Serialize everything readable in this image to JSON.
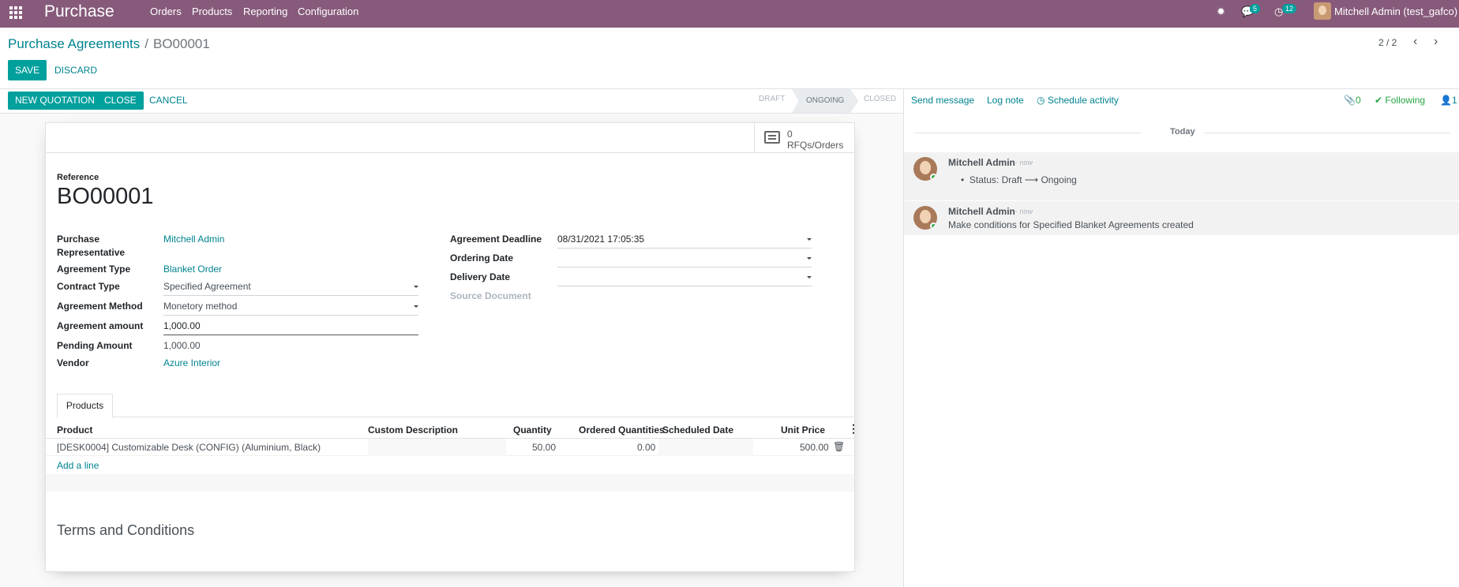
{
  "nav": {
    "brand": "Purchase",
    "menu": [
      "Orders",
      "Products",
      "Reporting",
      "Configuration"
    ],
    "bug_icon": "bug-icon",
    "messages_count": "5",
    "activities_count": "12",
    "user": "Mitchell Admin (test_gafco)"
  },
  "breadcrumb": {
    "parent": "Purchase Agreements",
    "current": "BO00001"
  },
  "actions": {
    "save": "SAVE",
    "discard": "DISCARD"
  },
  "pager": {
    "value": "2 / 2"
  },
  "header_buttons": {
    "new_quotation": "NEW QUOTATION",
    "close": "CLOSE",
    "cancel": "CANCEL"
  },
  "stages": [
    "DRAFT",
    "ONGOING",
    "CLOSED"
  ],
  "active_stage": "ONGOING",
  "stat_button": {
    "count": "0",
    "label": "RFQs/Orders"
  },
  "form": {
    "reference_label": "Reference",
    "reference": "BO00001",
    "purchase_rep_label_1": "Purchase",
    "purchase_rep_label_2": "Representative",
    "purchase_rep": "Mitchell Admin",
    "agreement_type_label": "Agreement Type",
    "agreement_type": "Blanket Order",
    "contract_type_label": "Contract Type",
    "contract_type": "Specified Agreement",
    "agreement_method_label": "Agreement Method",
    "agreement_method": "Monetory method",
    "agreement_amount_label": "Agreement amount",
    "agreement_amount": "1,000.00",
    "pending_amount_label": "Pending Amount",
    "pending_amount": "1,000.00",
    "vendor_label": "Vendor",
    "vendor": "Azure Interior",
    "deadline_label": "Agreement Deadline",
    "deadline": "08/31/2021 17:05:35",
    "ordering_date_label": "Ordering Date",
    "ordering_date": "",
    "delivery_date_label": "Delivery Date",
    "delivery_date": "",
    "source_doc_label": "Source Document"
  },
  "tabs": {
    "products": "Products"
  },
  "table": {
    "headers": [
      "Product",
      "Custom Description",
      "Quantity",
      "Ordered Quantities",
      "Scheduled Date",
      "Unit Price"
    ],
    "rows": [
      {
        "product": "[DESK0004] Customizable Desk (CONFIG) (Aluminium, Black)",
        "custom_description": "",
        "quantity": "50.00",
        "ordered": "0.00",
        "scheduled": "",
        "unit_price": "500.00"
      }
    ],
    "add_line": "Add a line"
  },
  "terms_title": "Terms and Conditions",
  "chatter": {
    "send_message": "Send message",
    "log_note": "Log note",
    "schedule_activity": "Schedule activity",
    "attachments": "0",
    "following": "Following",
    "followers": "1",
    "date_separator": "Today",
    "messages": [
      {
        "author": "Mitchell Admin",
        "time": "- now",
        "status_text": "Status: Draft",
        "arrow": "⟶",
        "status_new": "Ongoing"
      },
      {
        "author": "Mitchell Admin",
        "time": "- now",
        "body": "Make conditions for Specified Blanket Agreements created"
      }
    ]
  }
}
